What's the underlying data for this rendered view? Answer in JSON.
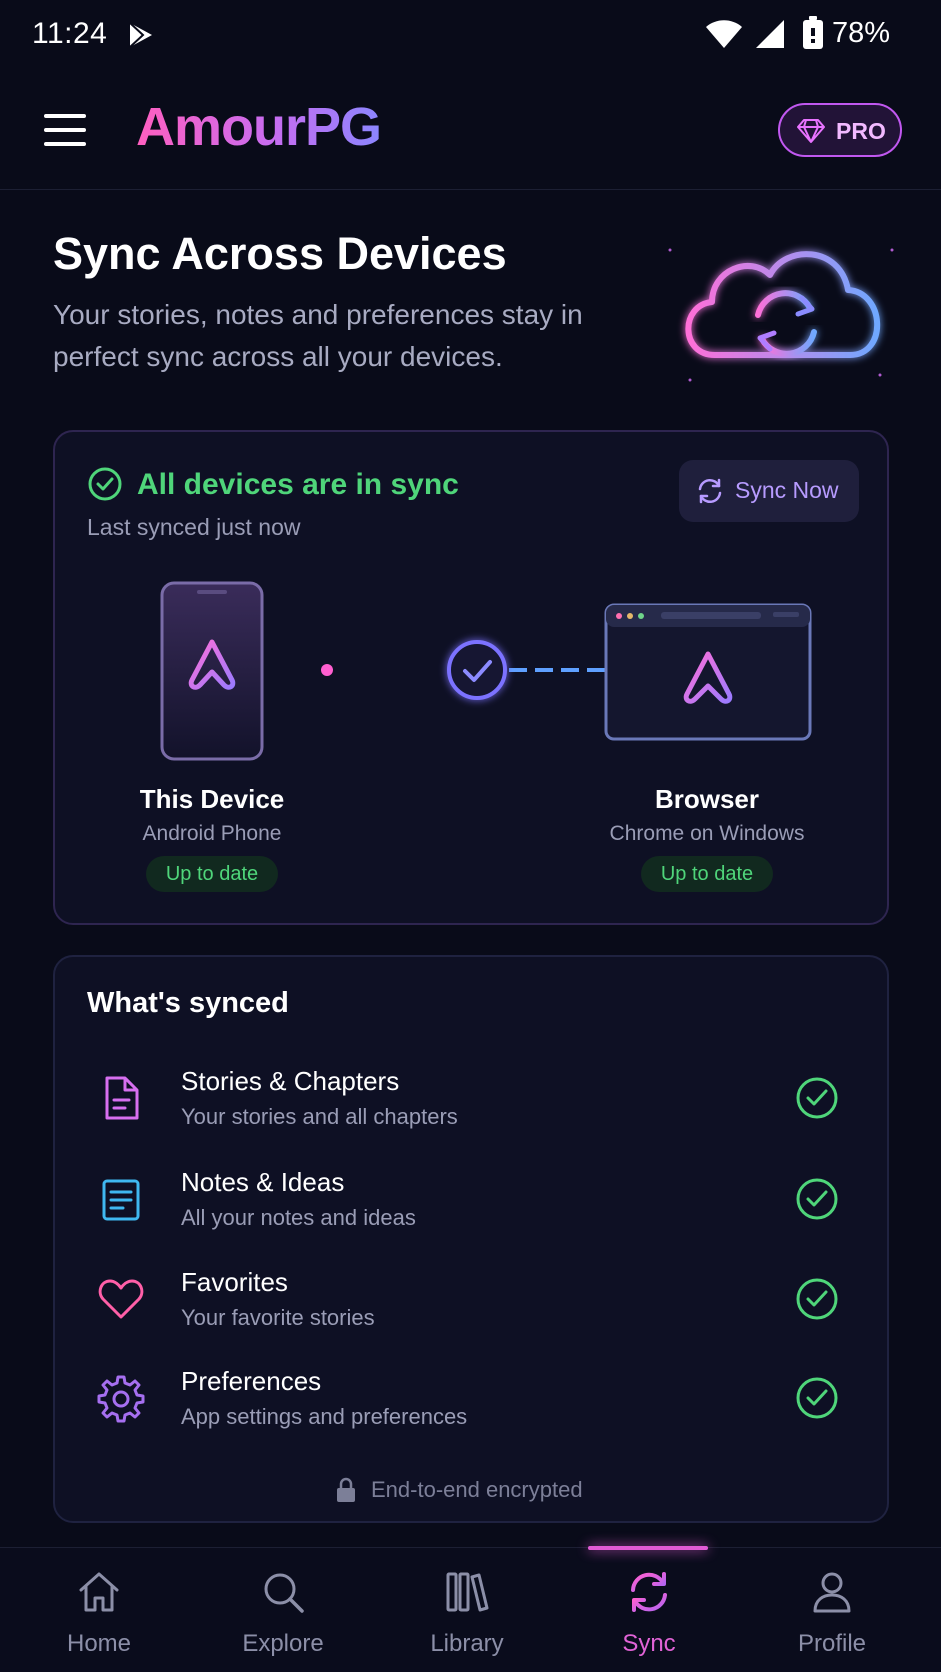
{
  "status_bar": {
    "time": "11:24",
    "battery": "78%"
  },
  "header": {
    "logo": "AmourPG",
    "pro_label": "PRO"
  },
  "hero": {
    "title": "Sync Across Devices",
    "subtitle": "Your stories, notes and preferences stay in perfect sync across all your devices."
  },
  "sync_status": {
    "status": "All devices are in sync",
    "last_synced": "Last synced just now",
    "sync_now_label": "Sync Now",
    "devices": [
      {
        "name": "This Device",
        "type": "Android Phone",
        "badge": "Up to date"
      },
      {
        "name": "Browser",
        "type": "Chrome on Windows",
        "badge": "Up to date"
      }
    ]
  },
  "whats_synced": {
    "title": "What's synced",
    "items": [
      {
        "title": "Stories & Chapters",
        "desc": "Your stories and all chapters"
      },
      {
        "title": "Notes & Ideas",
        "desc": "All your notes and ideas"
      },
      {
        "title": "Favorites",
        "desc": "Your favorite stories"
      },
      {
        "title": "Preferences",
        "desc": "App settings and preferences"
      }
    ],
    "footer": "End-to-end encrypted"
  },
  "nav": {
    "items": [
      {
        "label": "Home"
      },
      {
        "label": "Explore"
      },
      {
        "label": "Library"
      },
      {
        "label": "Sync"
      },
      {
        "label": "Profile"
      }
    ],
    "active": "Sync"
  },
  "colors": {
    "background": "#090b19",
    "accent_pink": "#e25bd5",
    "accent_purple": "#8b86ff",
    "success": "#4fd57a"
  }
}
